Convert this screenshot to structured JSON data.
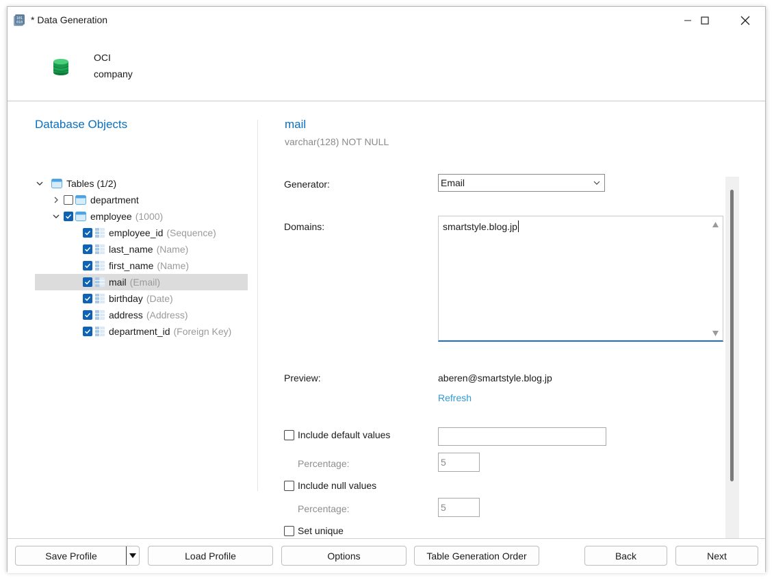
{
  "window": {
    "title": "* Data Generation",
    "controls": {
      "minimize": "minimize-icon",
      "maximize": "maximize-icon",
      "close": "close-icon"
    }
  },
  "header": {
    "connection": "OCI",
    "database": "company"
  },
  "left": {
    "title": "Database Objects",
    "tree": {
      "root": {
        "label": "Tables (1/2)",
        "expanded": true
      },
      "tables": [
        {
          "name": "department",
          "checked": false,
          "expanded": false
        },
        {
          "name": "employee",
          "count": "(1000)",
          "checked": true,
          "expanded": true
        }
      ],
      "columns": [
        {
          "name": "employee_id",
          "hint": "(Sequence)",
          "checked": true
        },
        {
          "name": "last_name",
          "hint": "(Name)",
          "checked": true
        },
        {
          "name": "first_name",
          "hint": "(Name)",
          "checked": true
        },
        {
          "name": "mail",
          "hint": "(Email)",
          "checked": true,
          "selected": true
        },
        {
          "name": "birthday",
          "hint": "(Date)",
          "checked": true
        },
        {
          "name": "address",
          "hint": "(Address)",
          "checked": true
        },
        {
          "name": "department_id",
          "hint": "(Foreign Key)",
          "checked": true
        }
      ]
    }
  },
  "right": {
    "field_name": "mail",
    "field_type": "varchar(128) NOT NULL",
    "generator_label": "Generator:",
    "generator_value": "Email",
    "domains_label": "Domains:",
    "domains_value": "smartstyle.blog.jp",
    "preview_label": "Preview:",
    "preview_value": "aberen@smartstyle.blog.jp",
    "refresh_label": "Refresh",
    "include_default_label": "Include default values",
    "include_default_checked": false,
    "default_value": "",
    "percentage_label_1": "Percentage:",
    "percentage_value_1": "5",
    "include_null_label": "Include null values",
    "include_null_checked": false,
    "percentage_label_2": "Percentage:",
    "percentage_value_2": "5",
    "set_unique_label": "Set unique",
    "set_unique_checked": false
  },
  "footer": {
    "save_profile": "Save Profile",
    "load_profile": "Load Profile",
    "options": "Options",
    "table_generation_order": "Table Generation Order",
    "back": "Back",
    "next": "Next"
  },
  "colors": {
    "accent": "#0a6fbf",
    "link": "#2e9ad6",
    "checkbox": "#0f63b5",
    "selection": "#dcdcdc"
  }
}
